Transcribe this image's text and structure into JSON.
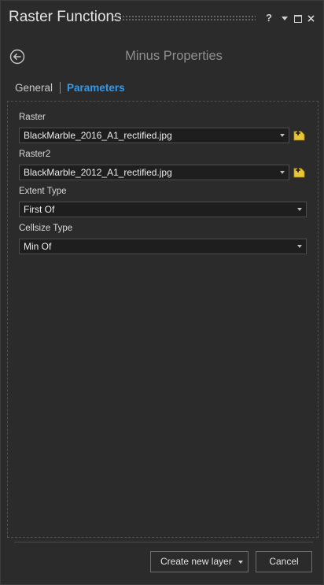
{
  "window": {
    "title": "Raster Functions",
    "help_label": "?"
  },
  "header": {
    "title": "Minus Properties"
  },
  "tabs": [
    {
      "label": "General",
      "active": false
    },
    {
      "label": "Parameters",
      "active": true
    }
  ],
  "form": {
    "raster": {
      "label": "Raster",
      "value": "BlackMarble_2016_A1_rectified.jpg"
    },
    "raster2": {
      "label": "Raster2",
      "value": "BlackMarble_2012_A1_rectified.jpg"
    },
    "extent_type": {
      "label": "Extent Type",
      "value": "First Of"
    },
    "cellsize_type": {
      "label": "Cellsize Type",
      "value": "Min Of"
    }
  },
  "footer": {
    "create_label": "Create new layer",
    "cancel_label": "Cancel"
  },
  "colors": {
    "accent": "#2d9bf0",
    "background": "#2b2b2b",
    "field_bg": "#1e1e1e",
    "add_icon": "#e8c53a"
  }
}
